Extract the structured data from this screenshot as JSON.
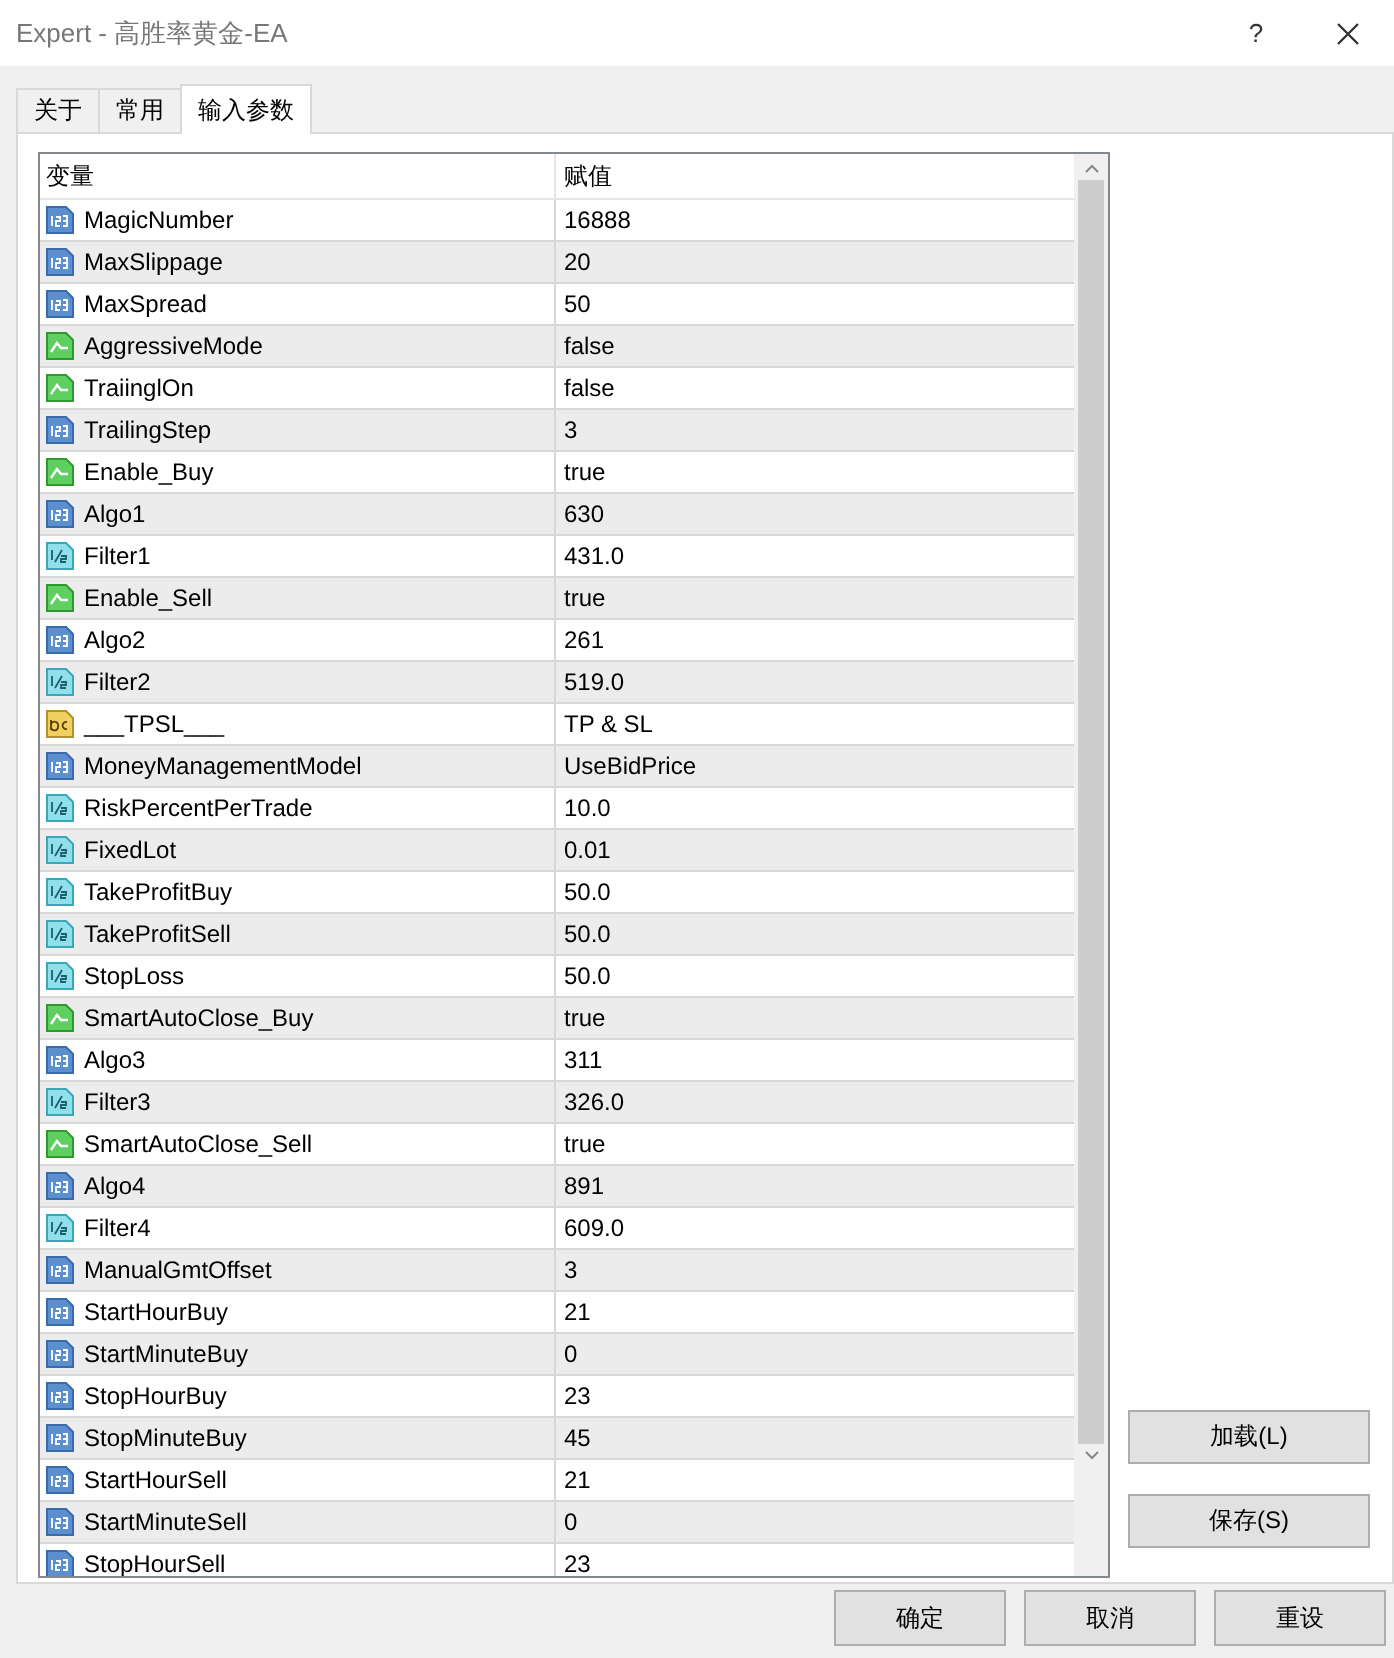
{
  "window": {
    "title": "Expert - 高胜率黄金-EA",
    "help": "?"
  },
  "tabs": [
    {
      "label": "关于",
      "selected": false
    },
    {
      "label": "常用",
      "selected": false
    },
    {
      "label": "输入参数",
      "selected": true
    }
  ],
  "table": {
    "columns": [
      "变量",
      "赋值"
    ],
    "rows": [
      {
        "kind": "int",
        "name": "MagicNumber",
        "value": "16888"
      },
      {
        "kind": "int",
        "name": "MaxSlippage",
        "value": "20"
      },
      {
        "kind": "int",
        "name": "MaxSpread",
        "value": "50"
      },
      {
        "kind": "bool",
        "name": "AggressiveMode",
        "value": "false"
      },
      {
        "kind": "bool",
        "name": "TraiinglOn",
        "value": "false"
      },
      {
        "kind": "int",
        "name": "TrailingStep",
        "value": "3"
      },
      {
        "kind": "bool",
        "name": "Enable_Buy",
        "value": "true"
      },
      {
        "kind": "int",
        "name": "Algo1",
        "value": "630"
      },
      {
        "kind": "double",
        "name": "Filter1",
        "value": "431.0"
      },
      {
        "kind": "bool",
        "name": "Enable_Sell",
        "value": "true"
      },
      {
        "kind": "int",
        "name": "Algo2",
        "value": "261"
      },
      {
        "kind": "double",
        "name": "Filter2",
        "value": "519.0"
      },
      {
        "kind": "string",
        "name": "___TPSL___",
        "value": "TP & SL"
      },
      {
        "kind": "int",
        "name": "MoneyManagementModel",
        "value": "UseBidPrice"
      },
      {
        "kind": "double",
        "name": "RiskPercentPerTrade",
        "value": "10.0"
      },
      {
        "kind": "double",
        "name": "FixedLot",
        "value": "0.01"
      },
      {
        "kind": "double",
        "name": "TakeProfitBuy",
        "value": "50.0"
      },
      {
        "kind": "double",
        "name": "TakeProfitSell",
        "value": "50.0"
      },
      {
        "kind": "double",
        "name": "StopLoss",
        "value": "50.0"
      },
      {
        "kind": "bool",
        "name": "SmartAutoClose_Buy",
        "value": "true"
      },
      {
        "kind": "int",
        "name": "Algo3",
        "value": "311"
      },
      {
        "kind": "double",
        "name": "Filter3",
        "value": "326.0"
      },
      {
        "kind": "bool",
        "name": "SmartAutoClose_Sell",
        "value": "true"
      },
      {
        "kind": "int",
        "name": "Algo4",
        "value": "891"
      },
      {
        "kind": "double",
        "name": "Filter4",
        "value": "609.0"
      },
      {
        "kind": "int",
        "name": "ManualGmtOffset",
        "value": "3"
      },
      {
        "kind": "int",
        "name": "StartHourBuy",
        "value": "21"
      },
      {
        "kind": "int",
        "name": "StartMinuteBuy",
        "value": "0"
      },
      {
        "kind": "int",
        "name": "StopHourBuy",
        "value": "23"
      },
      {
        "kind": "int",
        "name": "StopMinuteBuy",
        "value": "45"
      },
      {
        "kind": "int",
        "name": "StartHourSell",
        "value": "21"
      },
      {
        "kind": "int",
        "name": "StartMinuteSell",
        "value": "0"
      },
      {
        "kind": "int",
        "name": "StopHourSell",
        "value": "23"
      }
    ]
  },
  "side_buttons": [
    "加载(L)",
    "保存(S)"
  ],
  "buttons": [
    "确定",
    "取消",
    "重设"
  ]
}
